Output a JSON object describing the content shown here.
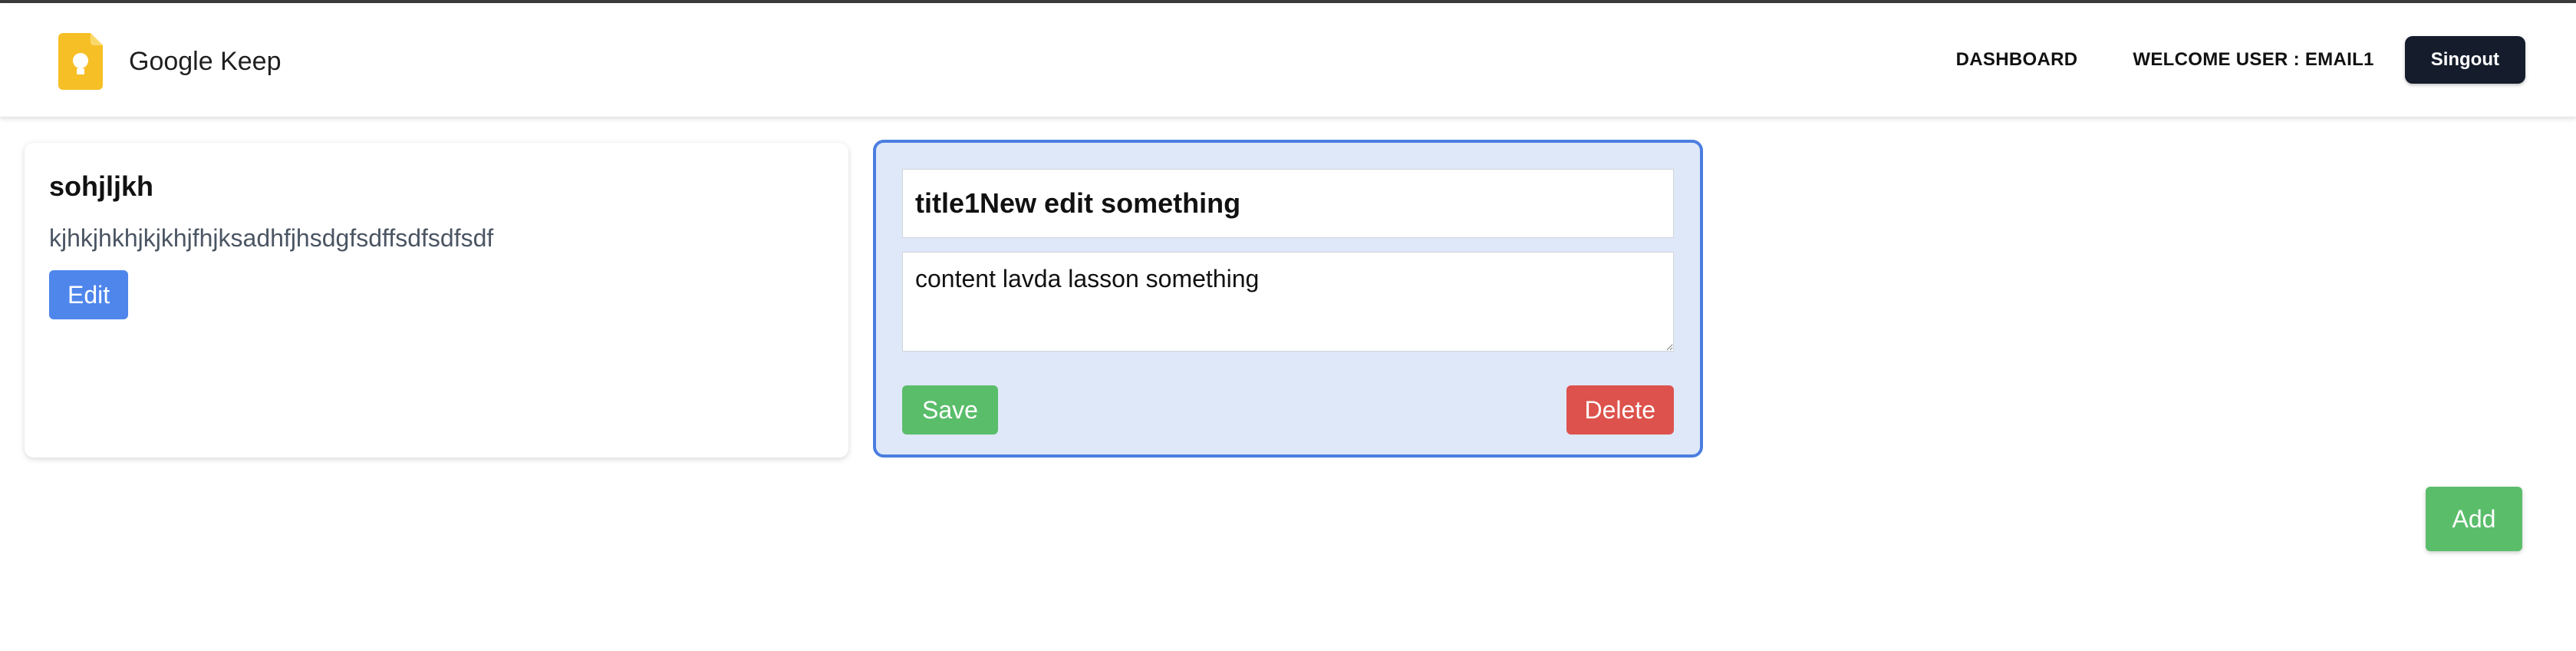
{
  "header": {
    "brand_name": "Google Keep",
    "logo_icon": "keep-lightbulb-icon",
    "logo_color": "#F6BF26",
    "nav": {
      "dashboard_label": "DASHBOARD",
      "welcome_label": "WELCOME USER : EMAIL1",
      "signout_label": "Singout"
    }
  },
  "notes": [
    {
      "title": "sohjljkh",
      "content": "kjhkjhkhjkjkhjfhjksadhfjhsdgfsdffsdfsdfsdf",
      "edit_label": "Edit"
    }
  ],
  "editor": {
    "title_value": "title1New edit something",
    "content_value": "content lavda lasson something",
    "save_label": "Save",
    "delete_label": "Delete"
  },
  "actions": {
    "add_label": "Add"
  },
  "colors": {
    "navbar_button": "#151C2C",
    "edit_button": "#4E86EC",
    "save_button": "#5ABD6A",
    "delete_button": "#DD524C",
    "add_button": "#5ABD6A",
    "editor_background": "#DFE8F9",
    "editor_border": "#4A7EE0"
  }
}
